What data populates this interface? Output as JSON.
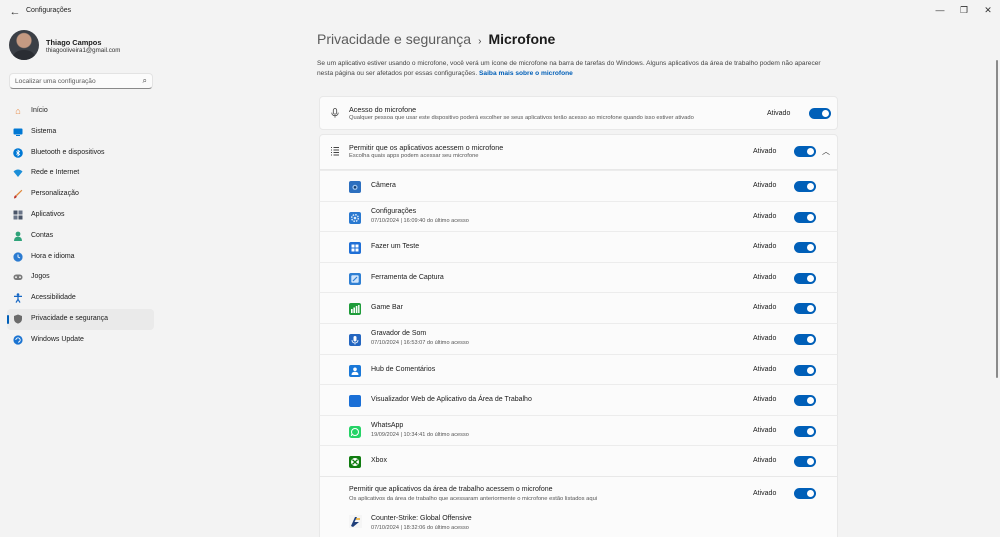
{
  "window": {
    "title": "Configurações",
    "back": "←",
    "min": "—",
    "max": "❐",
    "close": "✕"
  },
  "profile": {
    "name": "Thiago Campos",
    "email": "thiagooliveira1@gmail.com"
  },
  "search": {
    "placeholder": "Localizar uma configuração",
    "icon": "search-icon"
  },
  "sidebar": {
    "items": [
      {
        "label": "Início",
        "icon": "home-icon",
        "color": "#e8853c"
      },
      {
        "label": "Sistema",
        "icon": "monitor-icon",
        "color": "#0078d4"
      },
      {
        "label": "Bluetooth e dispositivos",
        "icon": "bluetooth-icon",
        "color": "#0078d4"
      },
      {
        "label": "Rede e Internet",
        "icon": "wifi-icon",
        "color": "#1b8ed8"
      },
      {
        "label": "Personalização",
        "icon": "brush-icon",
        "color": "#e0883a"
      },
      {
        "label": "Aplicativos",
        "icon": "apps-icon",
        "color": "#4a5568"
      },
      {
        "label": "Contas",
        "icon": "person-icon",
        "color": "#2fa37a"
      },
      {
        "label": "Hora e idioma",
        "icon": "globe-clock-icon",
        "color": "#2b7bd1"
      },
      {
        "label": "Jogos",
        "icon": "gamepad-icon",
        "color": "#6b6b6b"
      },
      {
        "label": "Acessibilidade",
        "icon": "accessibility-icon",
        "color": "#1466c4"
      },
      {
        "label": "Privacidade e segurança",
        "icon": "shield-icon",
        "color": "#6b6b6b"
      },
      {
        "label": "Windows Update",
        "icon": "update-icon",
        "color": "#1a73d1"
      }
    ]
  },
  "breadcrumb": {
    "parent": "Privacidade e segurança",
    "separator": "›",
    "current": "Microfone"
  },
  "description": {
    "text": "Se um aplicativo estiver usando o microfone, você verá um ícone de microfone na barra de tarefas do Windows. Alguns aplicativos da área de trabalho podem não aparecer nesta página ou ser afetados por essas configurações.",
    "link": "Saiba mais sobre o microfone"
  },
  "mic_access": {
    "title": "Acesso do microfone",
    "subtitle": "Qualquer pessoa que usar este dispositivo poderá escolher se seus aplicativos terão acesso ao microfone quando isso estiver ativado",
    "state": "Ativado",
    "icon": "microphone-icon"
  },
  "apps_access": {
    "title": "Permitir que os aplicativos acessem o microfone",
    "subtitle": "Escolha quais apps podem acessar seu microfone",
    "state": "Ativado",
    "icon": "list-icon"
  },
  "apps": [
    {
      "name": "Câmera",
      "date": "",
      "state": "Ativado",
      "color": "#2c6fbf"
    },
    {
      "name": "Configurações",
      "date": "07/10/2024  |  16:09:40 do último acesso",
      "state": "Ativado",
      "color": "#2a79d0"
    },
    {
      "name": "Fazer um Teste",
      "date": "",
      "state": "Ativado",
      "color": "#1f6fd6"
    },
    {
      "name": "Ferramenta de Captura",
      "date": "",
      "state": "Ativado",
      "color": "#2f7fd3"
    },
    {
      "name": "Game Bar",
      "date": "",
      "state": "Ativado",
      "color": "#1f9c3a"
    },
    {
      "name": "Gravador de Som",
      "date": "07/10/2024  |  16:53:07 do último acesso",
      "state": "Ativado",
      "color": "#2466c0"
    },
    {
      "name": "Hub de Comentários",
      "date": "",
      "state": "Ativado",
      "color": "#1a78d8"
    },
    {
      "name": "Visualizador Web de Aplicativo da Área de Trabalho",
      "date": "",
      "state": "Ativado",
      "color": "#1a6fd6"
    },
    {
      "name": "WhatsApp",
      "date": "19/09/2024  |  10:34:41 do último acesso",
      "state": "Ativado",
      "color": "#25d366"
    },
    {
      "name": "Xbox",
      "date": "",
      "state": "Ativado",
      "color": "#107c10"
    }
  ],
  "desktop_apps": {
    "title": "Permitir que aplicativos da área de trabalho acessem o microfone",
    "subtitle": "Os aplicativos da área de trabalho que acessaram anteriormente o microfone estão listados aqui",
    "state": "Ativado",
    "items": [
      {
        "name": "Counter-Strike: Global Offensive",
        "date": "07/10/2024  |  18:32:06 do último acesso"
      }
    ]
  },
  "colors": {
    "accent": "#005fb8",
    "toggle_on": "#005fb8"
  }
}
